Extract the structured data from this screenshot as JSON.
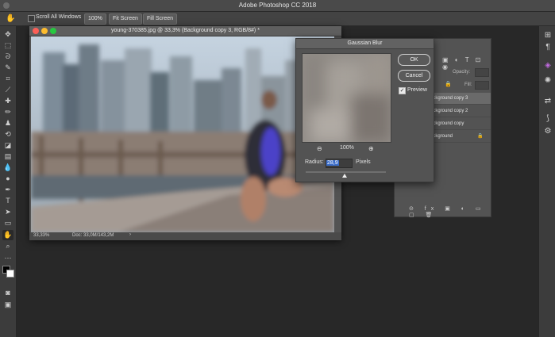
{
  "window": {
    "app_title": "Adobe Photoshop CC 2018"
  },
  "options_bar": {
    "scroll_all_windows_label": "Scroll All Windows",
    "zoom_button": "100%",
    "fit_screen_button": "Fit Screen",
    "fill_screen_button": "Fill Screen"
  },
  "document": {
    "title": "young-370385.jpg @ 33,3% (Background copy 3, RGB/8#) *",
    "status_zoom": "33,33%",
    "status_doc": "Doc: 33,0M/143,2M"
  },
  "layers_panel": {
    "opacity_label": "Opacity:",
    "fill_label": "Fill:",
    "layers": [
      {
        "name": "ackground copy 3",
        "selected": true
      },
      {
        "name": "ackground copy 2",
        "selected": false
      },
      {
        "name": "ackground copy",
        "selected": false
      },
      {
        "name": "ackground",
        "selected": false,
        "locked": true
      }
    ]
  },
  "dialog": {
    "title": "Gaussian Blur",
    "ok_label": "OK",
    "cancel_label": "Cancel",
    "preview_label": "Preview",
    "preview_checked": true,
    "zoom_value": "100%",
    "radius_label": "Radius:",
    "radius_value": "28,9",
    "radius_unit": "Pixels",
    "radius_slider_fraction": 0.49
  },
  "colors": {
    "accent_selection": "#3a6cc8",
    "panel": "#535353",
    "workspace": "#282828"
  }
}
